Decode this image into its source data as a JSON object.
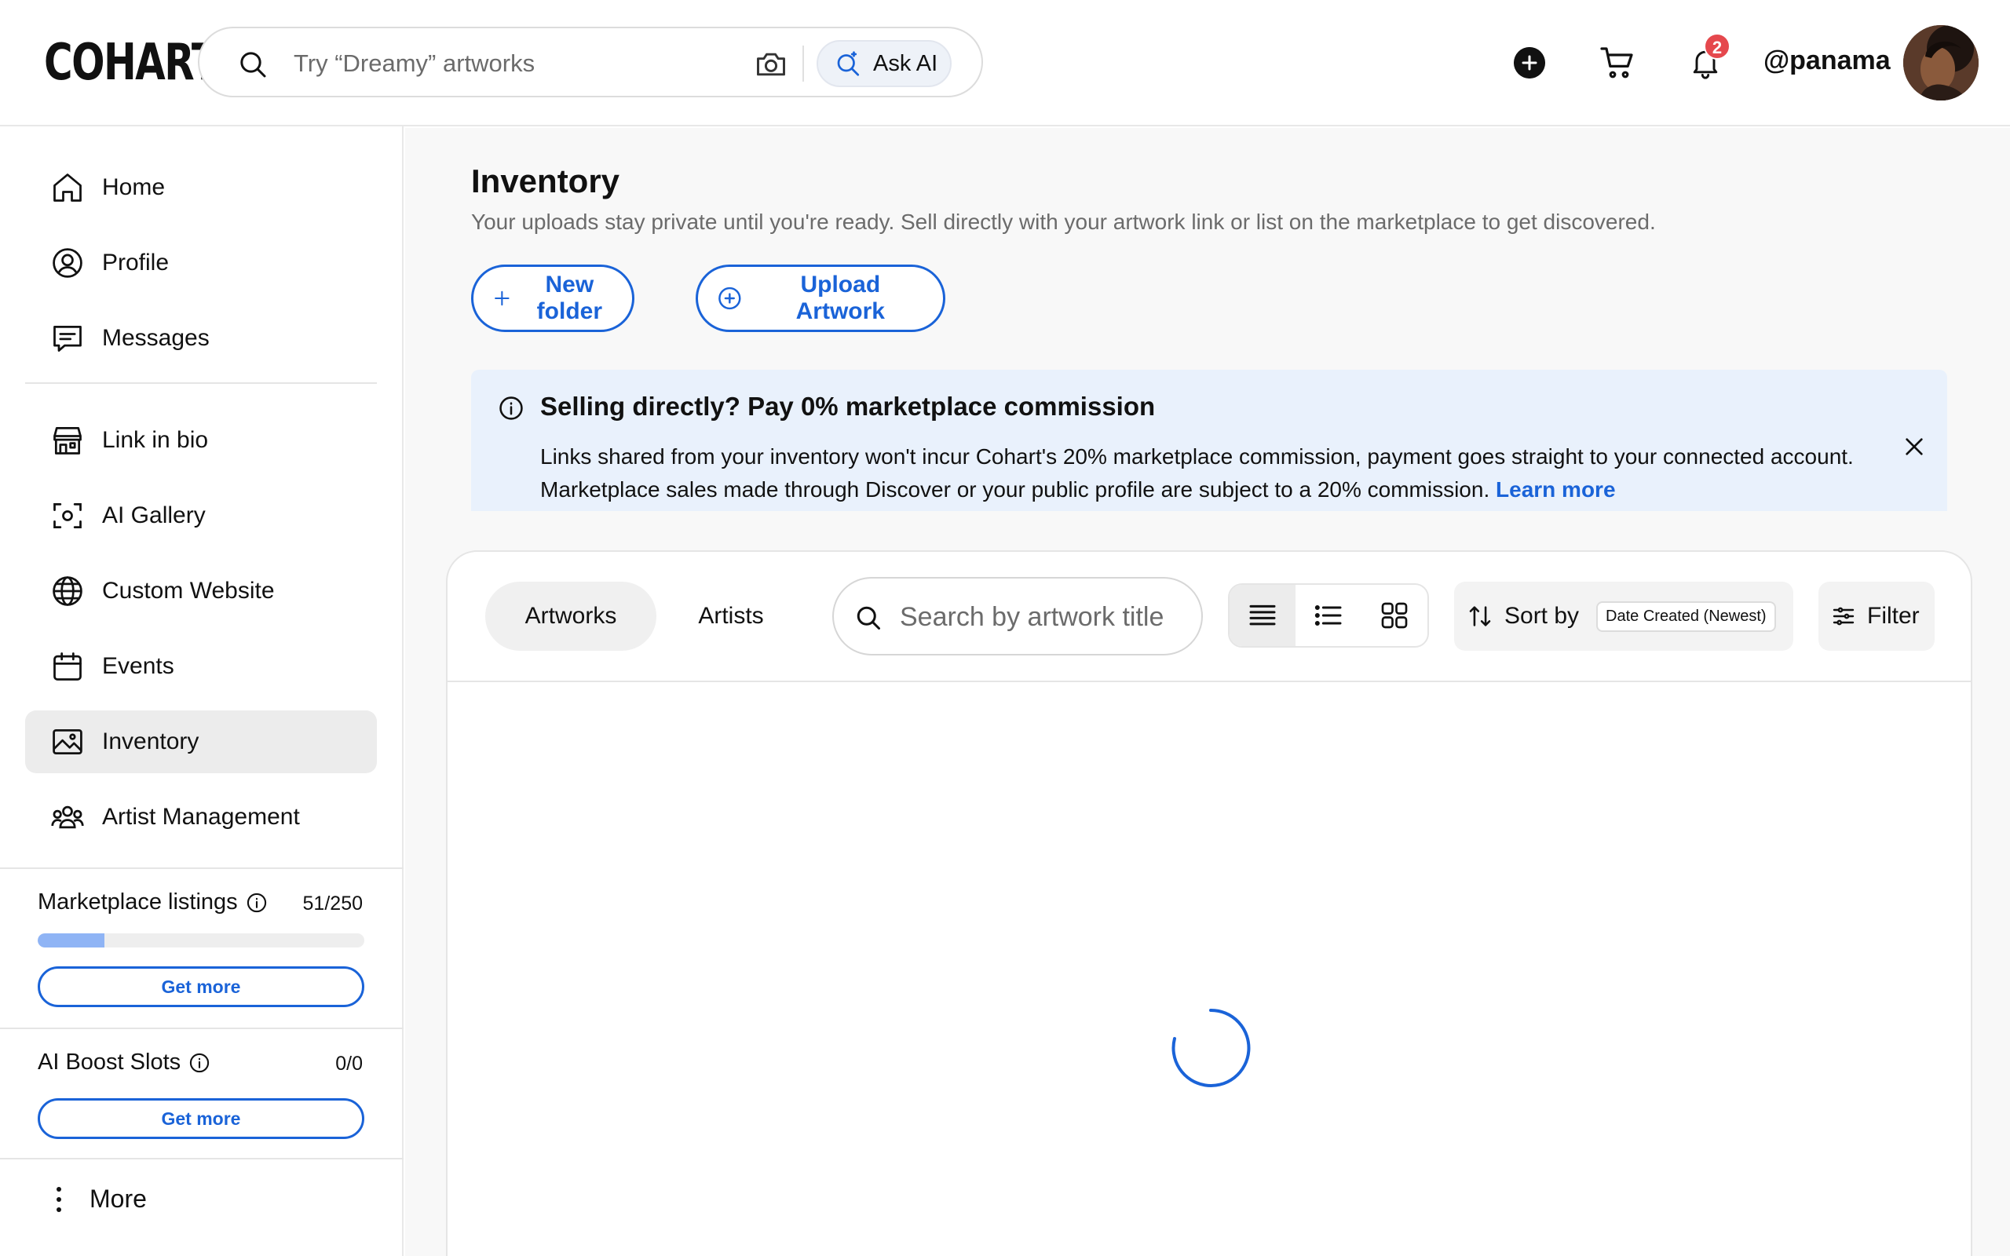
{
  "header": {
    "logo": "COHART",
    "search_placeholder": "Try “Dreamy” artworks",
    "ask_ai_label": "Ask AI",
    "notifications_count": "2",
    "username": "@panama"
  },
  "sidebar": {
    "items": [
      {
        "label": "Home",
        "icon": "home-icon"
      },
      {
        "label": "Profile",
        "icon": "user-circle-icon"
      },
      {
        "label": "Messages",
        "icon": "chat-icon"
      },
      {
        "label": "Link in bio",
        "icon": "storefront-icon"
      },
      {
        "label": "AI Gallery",
        "icon": "scan-icon"
      },
      {
        "label": "Custom Website",
        "icon": "globe-icon"
      },
      {
        "label": "Events",
        "icon": "calendar-icon"
      },
      {
        "label": "Inventory",
        "icon": "image-icon",
        "active": true
      },
      {
        "label": "Artist Management",
        "icon": "users-icon"
      }
    ],
    "marketplace": {
      "label": "Marketplace listings",
      "count": "51/250",
      "progress": 0.204,
      "button": "Get more"
    },
    "boost": {
      "label": "AI Boost Slots",
      "count": "0/0",
      "button": "Get more"
    },
    "more_label": "More"
  },
  "main": {
    "title": "Inventory",
    "subtitle": "Your uploads stay private until you're ready. Sell directly with your artwork link or list on the marketplace to get discovered.",
    "new_folder": "New folder",
    "upload_artwork": "Upload Artwork",
    "banner": {
      "title": "Selling directly? Pay 0% marketplace commission",
      "text": "Links shared from your inventory won't incur Cohart's 20% marketplace commission, payment goes straight to your connected account. Marketplace sales made through Discover or your public profile are subject to a 20% commission.",
      "link": "Learn more"
    },
    "tabs": [
      "Artworks",
      "Artists"
    ],
    "search_placeholder": "Search by artwork title",
    "sort_label": "Sort by",
    "sort_value": "Date Created (Newest)",
    "filter_label": "Filter"
  },
  "colors": {
    "accent": "#1a63d8",
    "banner_bg": "#e9f1fc",
    "badge": "#e5484d",
    "progress": "#8fb4f5"
  }
}
